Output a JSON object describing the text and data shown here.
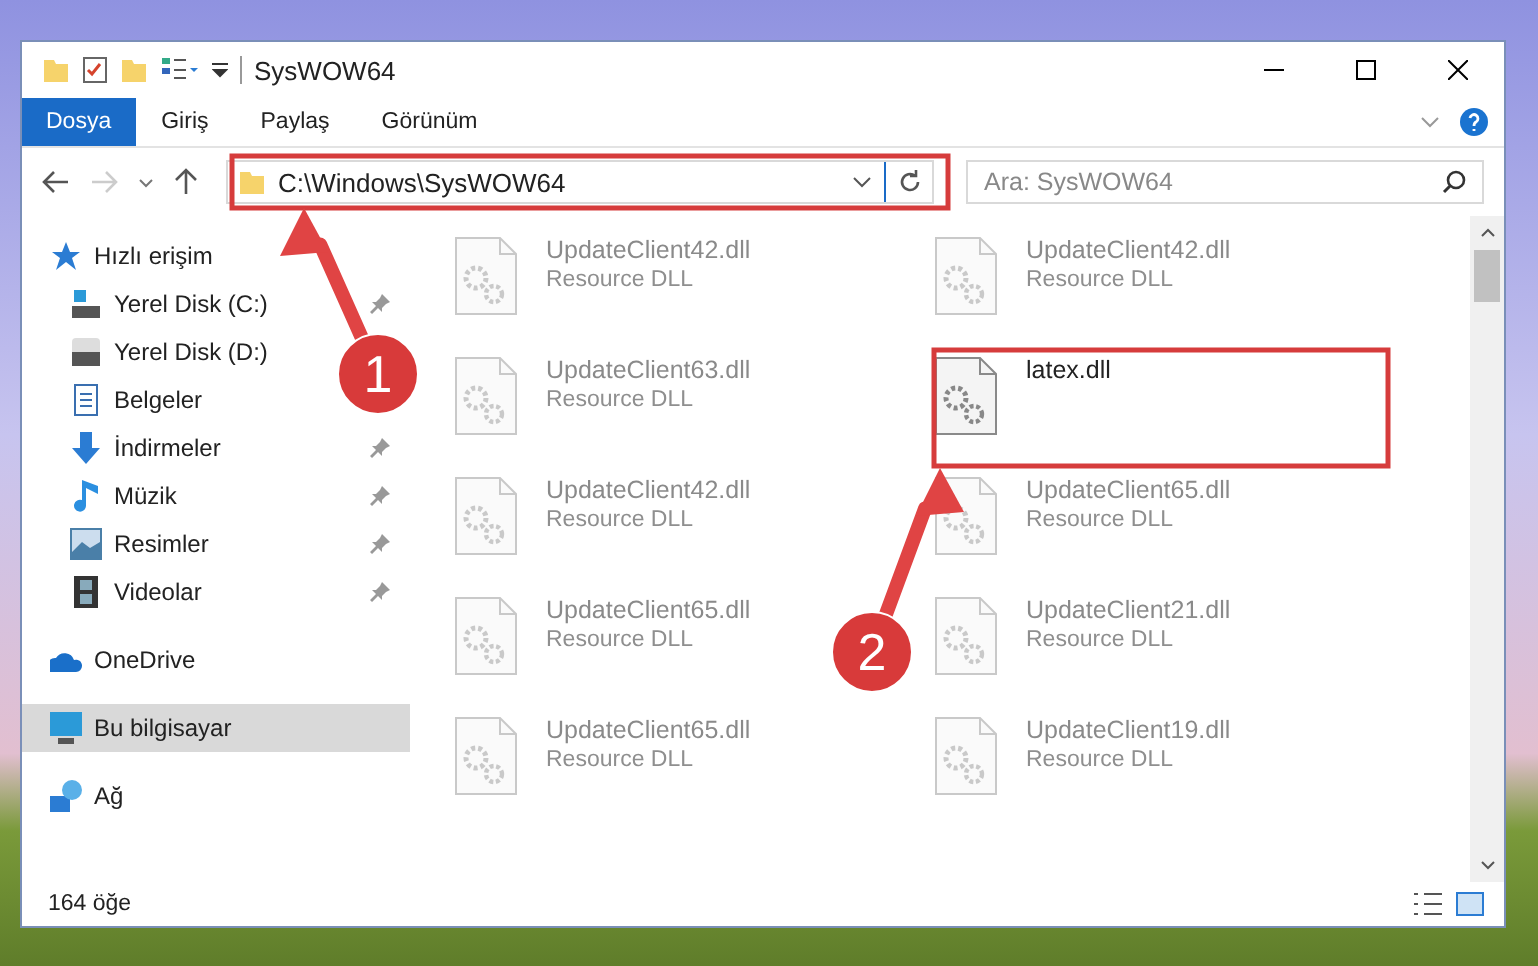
{
  "window": {
    "title": "SysWOW64"
  },
  "ribbon_tabs": [
    {
      "label": "Dosya",
      "selected": true
    },
    {
      "label": "Giriş",
      "selected": false
    },
    {
      "label": "Paylaş",
      "selected": false
    },
    {
      "label": "Görünüm",
      "selected": false
    }
  ],
  "address_bar": {
    "path": "C:\\Windows\\SysWOW64"
  },
  "search": {
    "placeholder": "Ara: SysWOW64"
  },
  "sidebar": {
    "items": [
      {
        "label": "Hızlı erişim",
        "kind": "star",
        "selected": false,
        "children": [
          {
            "label": "Yerel Disk (C:)",
            "kind": "sysdrive",
            "pinned": true,
            "selected": false
          },
          {
            "label": "Yerel Disk (D:)",
            "kind": "drive",
            "selected": false
          },
          {
            "label": "Belgeler",
            "kind": "document",
            "selected": false
          },
          {
            "label": "İndirmeler",
            "kind": "download",
            "pinned": true,
            "selected": false
          },
          {
            "label": "Müzik",
            "kind": "music",
            "pinned": true,
            "selected": false
          },
          {
            "label": "Resimler",
            "kind": "pictures",
            "pinned": true,
            "selected": false
          },
          {
            "label": "Videolar",
            "kind": "video",
            "pinned": true,
            "selected": false
          }
        ]
      },
      {
        "label": "OneDrive",
        "kind": "cloud",
        "selected": false
      },
      {
        "label": "Bu bilgisayar",
        "kind": "computer",
        "selected": true
      },
      {
        "label": "Ağ",
        "kind": "network",
        "selected": false
      }
    ]
  },
  "files": [
    {
      "name": "UpdateClient42.dll",
      "type": "Resource DLL",
      "dimmed": true
    },
    {
      "name": "UpdateClient42.dll",
      "type": "Resource DLL",
      "dimmed": true
    },
    {
      "name": "UpdateClient63.dll",
      "type": "Resource DLL",
      "dimmed": true
    },
    {
      "name": "latex.dll",
      "dimmed": false
    },
    {
      "name": "UpdateClient42.dll",
      "type": "Resource DLL",
      "dimmed": true
    },
    {
      "name": "UpdateClient65.dll",
      "type": "Resource DLL",
      "dimmed": true
    },
    {
      "name": "UpdateClient65.dll",
      "type": "Resource DLL",
      "dimmed": true
    },
    {
      "name": "UpdateClient21.dll",
      "type": "Resource DLL",
      "dimmed": true
    },
    {
      "name": "UpdateClient65.dll",
      "type": "Resource DLL",
      "dimmed": true
    },
    {
      "name": "UpdateClient19.dll",
      "type": "Resource DLL",
      "dimmed": true
    }
  ],
  "status_bar": {
    "item_count": "164 öğe"
  },
  "annotations": [
    {
      "number": "1"
    },
    {
      "number": "2"
    }
  ]
}
